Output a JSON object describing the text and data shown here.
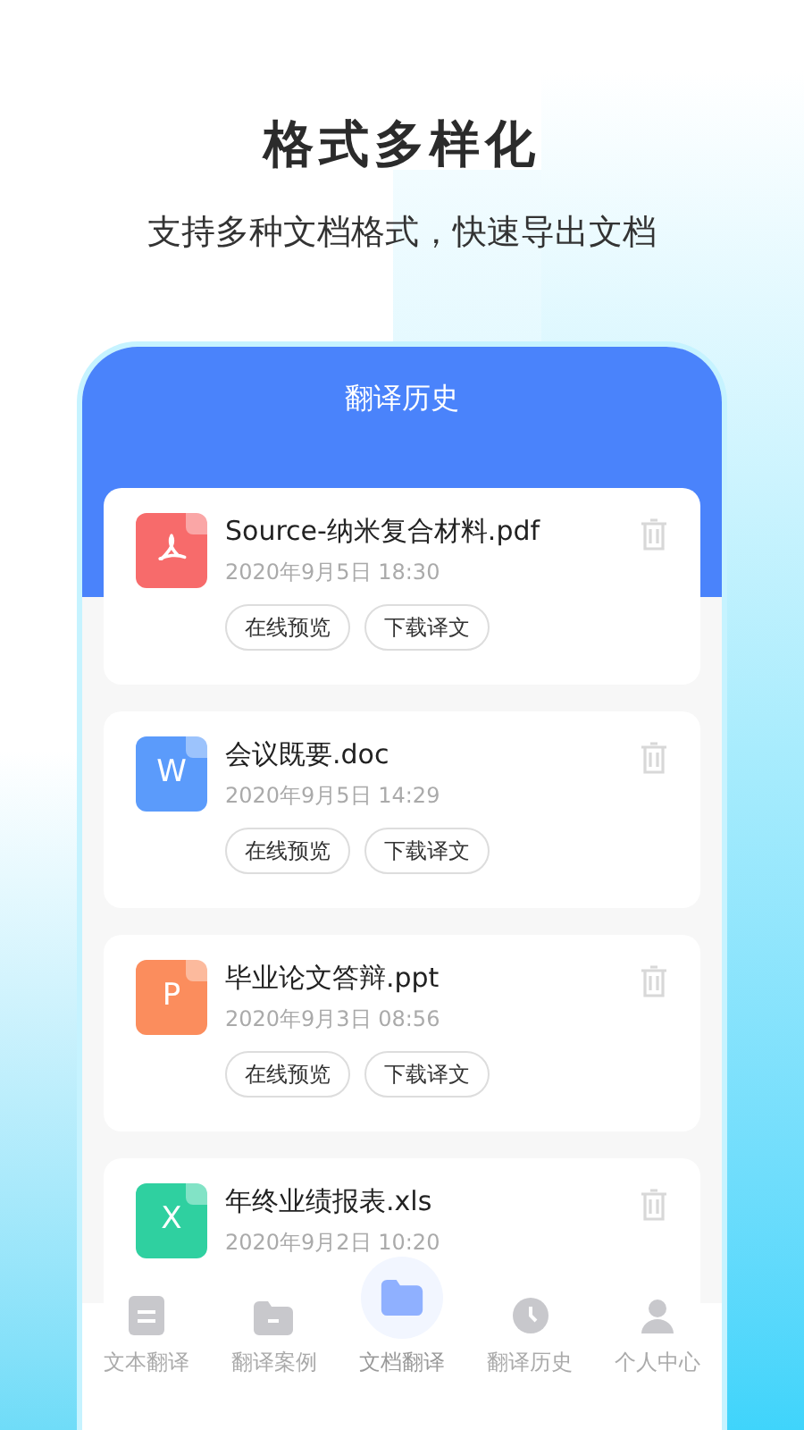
{
  "headline": "格式多样化",
  "subtitle": "支持多种文档格式，快速导出文档",
  "screen_title": "翻译历史",
  "files": [
    {
      "kind": "pdf",
      "color": "#f76b6b",
      "name": "Source-纳米复合材料.pdf",
      "time": "2020年9月5日 18:30",
      "actions": [
        "在线预览",
        "下载译文"
      ]
    },
    {
      "kind": "doc",
      "color": "#5b9bfb",
      "letter": "W",
      "name": "会议既要.doc",
      "time": "2020年9月5日 14:29",
      "actions": [
        "在线预览",
        "下载译文"
      ]
    },
    {
      "kind": "ppt",
      "color": "#fb8d5d",
      "letter": "P",
      "name": "毕业论文答辩.ppt",
      "time": "2020年9月3日 08:56",
      "actions": [
        "在线预览",
        "下载译文"
      ]
    },
    {
      "kind": "xls",
      "color": "#2fd0a0",
      "letter": "X",
      "name": "年终业绩报表.xls",
      "time": "2020年9月2日 10:20"
    }
  ],
  "nav": [
    {
      "label": "文本翻译",
      "selected": false
    },
    {
      "label": "翻译案例",
      "selected": false
    },
    {
      "label": "文档翻译",
      "selected": true
    },
    {
      "label": "翻译历史",
      "selected": false
    },
    {
      "label": "个人中心",
      "selected": false
    }
  ]
}
